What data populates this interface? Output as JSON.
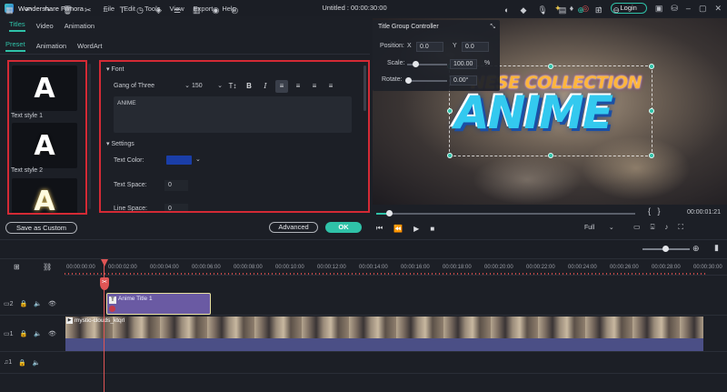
{
  "app": {
    "name": "Wondershare Filmora",
    "project_title": "Untitled : 00:00:30:00"
  },
  "menu": [
    "File",
    "Edit",
    "Tools",
    "View",
    "Export",
    "Help"
  ],
  "header_actions": {
    "login_label": "Login"
  },
  "top_tabs": [
    {
      "label": "Titles",
      "active": true
    },
    {
      "label": "Video",
      "active": false
    },
    {
      "label": "Animation",
      "active": false
    }
  ],
  "sub_tabs": [
    {
      "label": "Preset",
      "active": true
    },
    {
      "label": "Animation",
      "active": false
    },
    {
      "label": "WordArt",
      "active": false
    }
  ],
  "presets": [
    {
      "label": "Text style 1",
      "glyph": "A"
    },
    {
      "label": "Text style 2",
      "glyph": "A"
    },
    {
      "label": "",
      "glyph": "A"
    }
  ],
  "save_custom_label": "Save as Custom",
  "font_section": {
    "heading": "Font",
    "font_name": "Gang of Three",
    "font_size": "150",
    "text_value": "ANIME"
  },
  "settings_section": {
    "heading": "Settings",
    "text_color_label": "Text Color:",
    "text_color": "#1a3ea8",
    "text_space_label": "Text Space:",
    "text_space_value": "0",
    "line_space_label": "Line Space:",
    "line_space_value": "0"
  },
  "buttons": {
    "advanced": "Advanced",
    "ok": "OK"
  },
  "title_group": {
    "heading": "Title Group Controller",
    "position_label": "Position:",
    "x_label": "X",
    "x_value": "0.0",
    "y_label": "Y",
    "y_value": "0.0",
    "scale_label": "Scale:",
    "scale_value": "100.00",
    "scale_unit": "%",
    "rotate_label": "Rotate:",
    "rotate_value": "0.00°",
    "scale_level": 0.2,
    "rotate_level": 0.0
  },
  "preview": {
    "line1": "NESE COLLECTION",
    "line2": "ANIME",
    "timecode": "00:00:01:21",
    "quality": "Full",
    "progress": 0.05
  },
  "ruler_ticks": [
    "00:00:00:00",
    "00:00:02:00",
    "00:00:04:00",
    "00:00:06:00",
    "00:00:08:00",
    "00:00:10:00",
    "00:00:12:00",
    "00:00:14:00",
    "00:00:16:00",
    "00:00:18:00",
    "00:00:20:00",
    "00:00:22:00",
    "00:00:24:00",
    "00:00:26:00",
    "00:00:28:00",
    "00:00:30:00"
  ],
  "tracks": {
    "title_track": "2",
    "video_track": "1",
    "audio_track": "1"
  },
  "clips": {
    "title_clip": "Anime Title 1",
    "video_clip": "mystic-clouds_ktqrl"
  },
  "colors": {
    "accent": "#2fc2a8",
    "highlight_box": "#d42a35"
  }
}
